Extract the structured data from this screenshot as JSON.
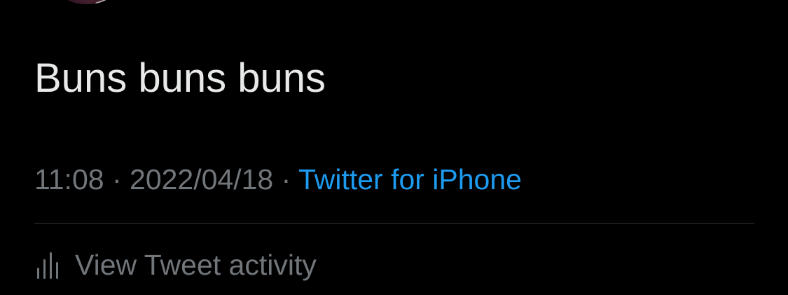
{
  "tweet": {
    "text": "Buns buns buns",
    "time": "11:08",
    "separator": "·",
    "date": "2022/04/18",
    "source": "Twitter for iPhone"
  },
  "activity": {
    "label": "View Tweet activity",
    "icon": "bar-chart-icon"
  },
  "colors": {
    "background": "#000000",
    "text": "#e7e9ea",
    "secondary": "#71767b",
    "link": "#1d9bf0",
    "divider": "#2f3336"
  }
}
